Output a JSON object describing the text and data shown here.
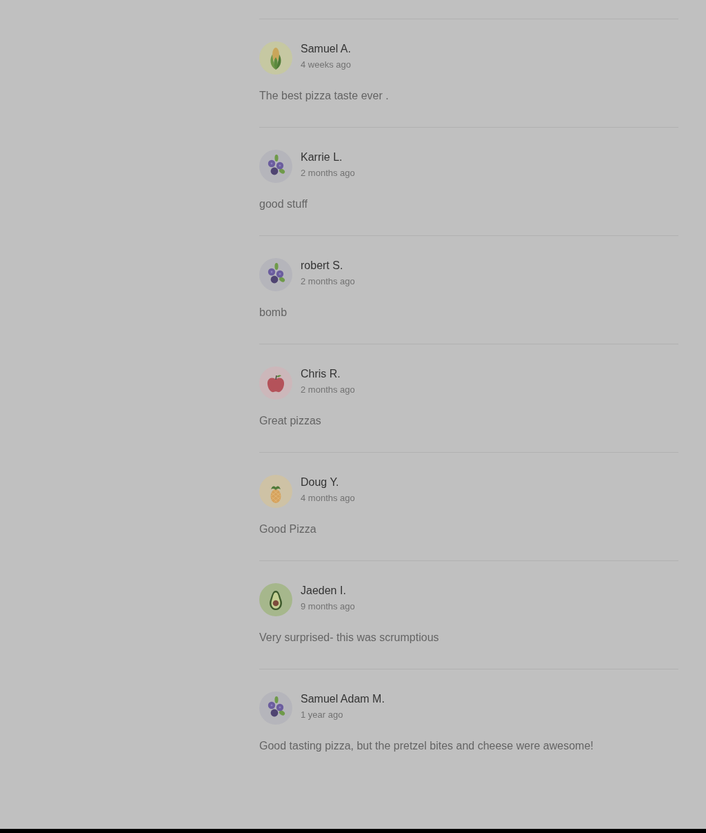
{
  "reviews": [
    {
      "name": "Samuel A.",
      "time": "4 weeks ago",
      "text": "The best pizza taste ever .",
      "avatar": {
        "kind": "corn"
      }
    },
    {
      "name": "Karrie L.",
      "time": "2 months ago",
      "text": "good stuff",
      "avatar": {
        "kind": "blueberries"
      }
    },
    {
      "name": "robert S.",
      "time": "2 months ago",
      "text": "bomb",
      "avatar": {
        "kind": "blueberries"
      }
    },
    {
      "name": "Chris R.",
      "time": "2 months ago",
      "text": "Great pizzas",
      "avatar": {
        "kind": "apple"
      }
    },
    {
      "name": "Doug Y.",
      "time": "4 months ago",
      "text": "Good Pizza",
      "avatar": {
        "kind": "pineapple"
      }
    },
    {
      "name": "Jaeden I.",
      "time": "9 months ago",
      "text": "Very surprised- this was scrumptious",
      "avatar": {
        "kind": "avocado"
      }
    },
    {
      "name": "Samuel Adam M.",
      "time": "1 year ago",
      "text": "Good tasting pizza, but the pretzel bites and cheese were awesome!",
      "avatar": {
        "kind": "blueberries"
      }
    }
  ]
}
